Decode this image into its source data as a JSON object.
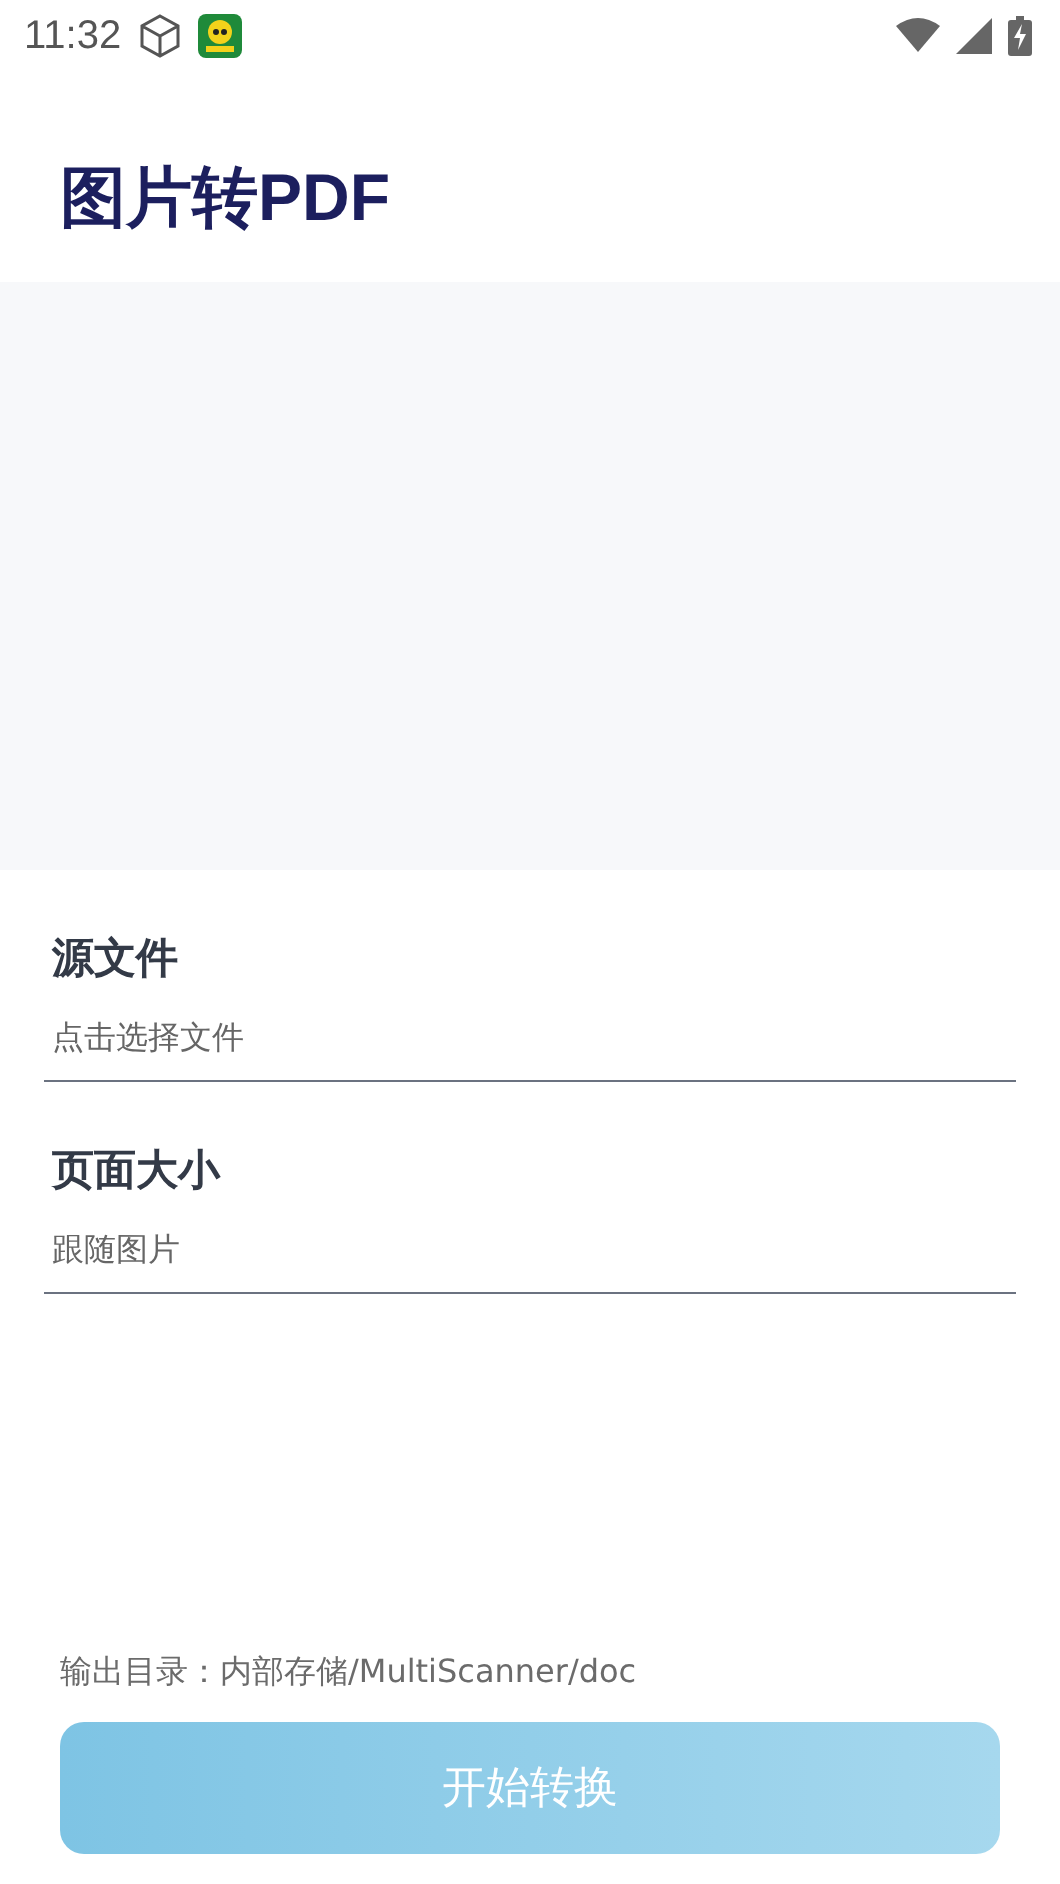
{
  "status_bar": {
    "time": "11:32"
  },
  "title": "图片转PDF",
  "fields": [
    {
      "label": "源文件",
      "value": "点击选择文件"
    },
    {
      "label": "页面大小",
      "value": "跟随图片"
    }
  ],
  "output_path": "输出目录：内部存储/MultiScanner/doc",
  "start_button": "开始转换"
}
